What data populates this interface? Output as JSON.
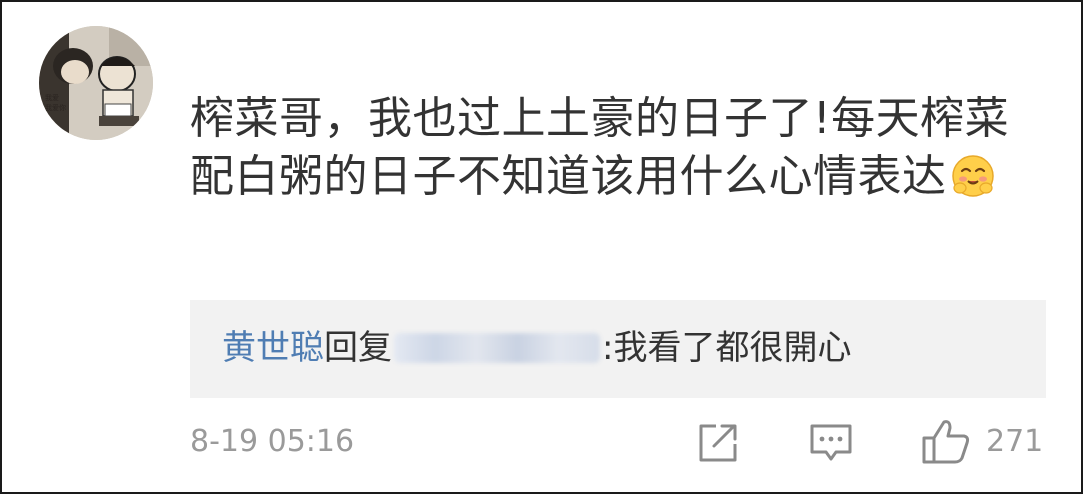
{
  "comment": {
    "text": "榨菜哥，我也过上土豪的日子了!每天榨菜配白粥的日子不知道该用什么心情表达",
    "emoji": "hug-emoji",
    "avatar_icon": "cartoon-avatar"
  },
  "reply": {
    "user": "黄世聪",
    "action_word": "回复",
    "separator": ":",
    "text": "我看了都很開心"
  },
  "meta": {
    "time": "8-19 05:16",
    "like_count": "271"
  },
  "icons": {
    "share": "share-icon",
    "comment": "comment-icon",
    "like": "thumbs-up-icon"
  },
  "colors": {
    "text": "#333333",
    "reply_user": "#4f7db3",
    "meta": "#9a9a9a",
    "reply_bg": "#f2f2f2"
  }
}
